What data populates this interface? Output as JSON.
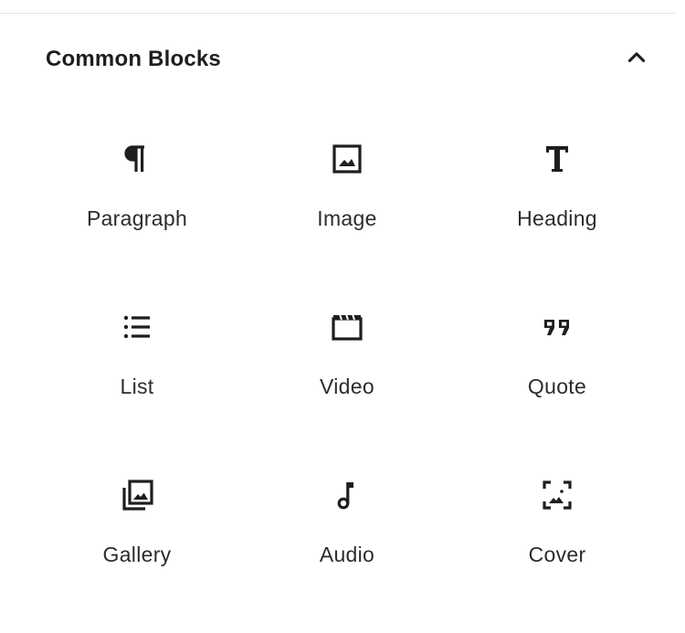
{
  "panel": {
    "title": "Common Blocks",
    "toggle_icon": "chevron-up-icon"
  },
  "blocks": [
    {
      "label": "Paragraph",
      "icon": "paragraph-icon"
    },
    {
      "label": "Image",
      "icon": "image-icon"
    },
    {
      "label": "Heading",
      "icon": "heading-icon"
    },
    {
      "label": "List",
      "icon": "list-icon"
    },
    {
      "label": "Video",
      "icon": "video-icon"
    },
    {
      "label": "Quote",
      "icon": "quote-icon"
    },
    {
      "label": "Gallery",
      "icon": "gallery-icon"
    },
    {
      "label": "Audio",
      "icon": "audio-icon"
    },
    {
      "label": "Cover",
      "icon": "cover-icon"
    }
  ],
  "colors": {
    "text": "#1e1e1e",
    "icon": "#1e1e1e",
    "divider": "#e2e4e7",
    "background": "#ffffff"
  }
}
